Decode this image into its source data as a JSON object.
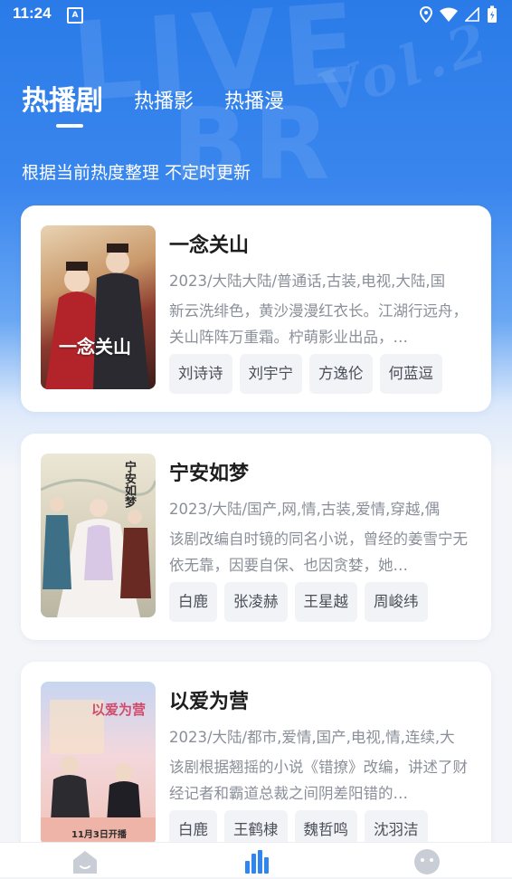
{
  "status_bar": {
    "time": "11:24",
    "notification_glyph": "A",
    "icons": [
      "location-icon",
      "wifi-icon",
      "signal-icon",
      "battery-icon"
    ]
  },
  "tabs": [
    {
      "label": "热播剧",
      "active": true
    },
    {
      "label": "热播影",
      "active": false
    },
    {
      "label": "热播漫",
      "active": false
    }
  ],
  "subtitle": "根据当前热度整理 不定时更新",
  "colors": {
    "accent": "#2a7be8",
    "nav_active": "#2f86f0",
    "nav_inactive": "#c9cdd6"
  },
  "shows": [
    {
      "title": "一念关山",
      "poster_text": "一念关山",
      "meta": "2023/大陆大陆/普通话,古装,电视,大陆,国",
      "description": "新云洗绯色，黄沙漫漫红衣长。江湖行远舟，关山阵阵万重霜。柠萌影业出品，…",
      "cast": [
        "刘诗诗",
        "刘宇宁",
        "方逸伦",
        "何蓝逗"
      ]
    },
    {
      "title": "宁安如梦",
      "poster_text": "宁安如梦",
      "meta": "2023/大陆/国产,网,情,古装,爱情,穿越,偶",
      "description": "该剧改编自时镜的同名小说，曾经的姜雪宁无依无靠，因要自保、也因贪婪，她…",
      "cast": [
        "白鹿",
        "张凌赫",
        "王星越",
        "周峻纬"
      ]
    },
    {
      "title": "以爱为营",
      "poster_text": "以爱为营",
      "poster_caption": "11月3日开播",
      "meta": "2023/大陆/都市,爱情,国产,电视,情,连续,大",
      "description": "该剧根据翘摇的小说《错撩》改编，讲述了财经记者和霸道总裁之间阴差阳错的…",
      "cast": [
        "白鹿",
        "王鹤棣",
        "魏哲鸣",
        "沈羽洁"
      ]
    }
  ],
  "bottom_nav": [
    {
      "icon": "home-icon",
      "active": false
    },
    {
      "icon": "chart-icon",
      "active": true
    },
    {
      "icon": "profile-icon",
      "active": false
    }
  ]
}
